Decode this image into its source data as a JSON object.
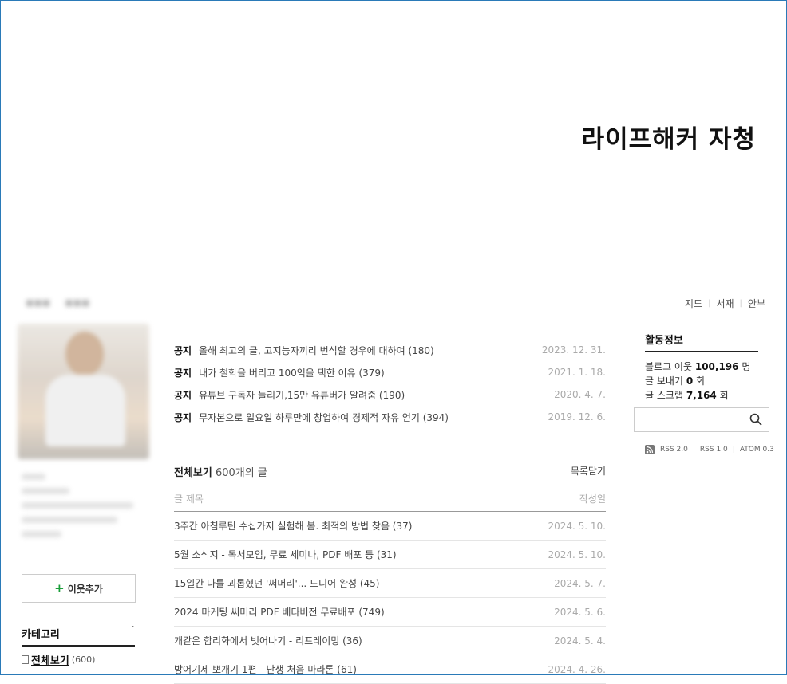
{
  "blog": {
    "title": "라이프해커 자청"
  },
  "top_links": [
    "지도",
    "서재",
    "안부"
  ],
  "left": {
    "add_neighbor": "이웃추가",
    "category": {
      "title": "카테고리",
      "all_label": "전체보기",
      "all_count": "(600)"
    }
  },
  "notices": [
    {
      "tag": "공지",
      "title": "올해 최고의 글, 고지능자끼리 번식할 경우에 대하여 (180)",
      "date": "2023. 12. 31."
    },
    {
      "tag": "공지",
      "title": "내가 철학을 버리고 100억을 택한 이유 (379)",
      "date": "2021. 1. 18."
    },
    {
      "tag": "공지",
      "title": "유튜브 구독자 늘리기,15만 유튜버가 알려줌 (190)",
      "date": "2020. 4. 7."
    },
    {
      "tag": "공지",
      "title": "무자본으로 일요일 하루만에 창업하여 경제적 자유 얻기 (394)",
      "date": "2019. 12. 6."
    }
  ],
  "list": {
    "all_label": "전체보기",
    "count_label": "600개의 글",
    "close_label": "목록닫기",
    "col_title": "글 제목",
    "col_date": "작성일",
    "posts": [
      {
        "title": "3주간 아침루틴 수십가지 실험해 봄. 최적의 방법 찾음 (37)",
        "date": "2024. 5. 10."
      },
      {
        "title": "5월 소식지 - 독서모임, 무료 세미나, PDF 배포 등 (31)",
        "date": "2024. 5. 10."
      },
      {
        "title": "15일간 나를 괴롭혔던 '써머리'... 드디어 완성 (45)",
        "date": "2024. 5. 7."
      },
      {
        "title": "2024 마케팅 써머리 PDF 베타버전 무료배포 (749)",
        "date": "2024. 5. 6."
      },
      {
        "title": "개같은 합리화에서 벗어나기 - 리프레이밍 (36)",
        "date": "2024. 5. 4."
      },
      {
        "title": "방어기제 뽀개기 1편 - 난생 처음 마라톤 (61)",
        "date": "2024. 4. 26."
      }
    ]
  },
  "activity": {
    "title": "활동정보",
    "neighbors_label": "블로그 이웃",
    "neighbors_value": "100,196",
    "neighbors_unit": "명",
    "send_label": "글 보내기",
    "send_value": "0",
    "send_unit": "회",
    "scrap_label": "글 스크랩",
    "scrap_value": "7,164",
    "scrap_unit": "회"
  },
  "search": {
    "placeholder": ""
  },
  "feeds": [
    "RSS 2.0",
    "RSS 1.0",
    "ATOM 0.3"
  ]
}
